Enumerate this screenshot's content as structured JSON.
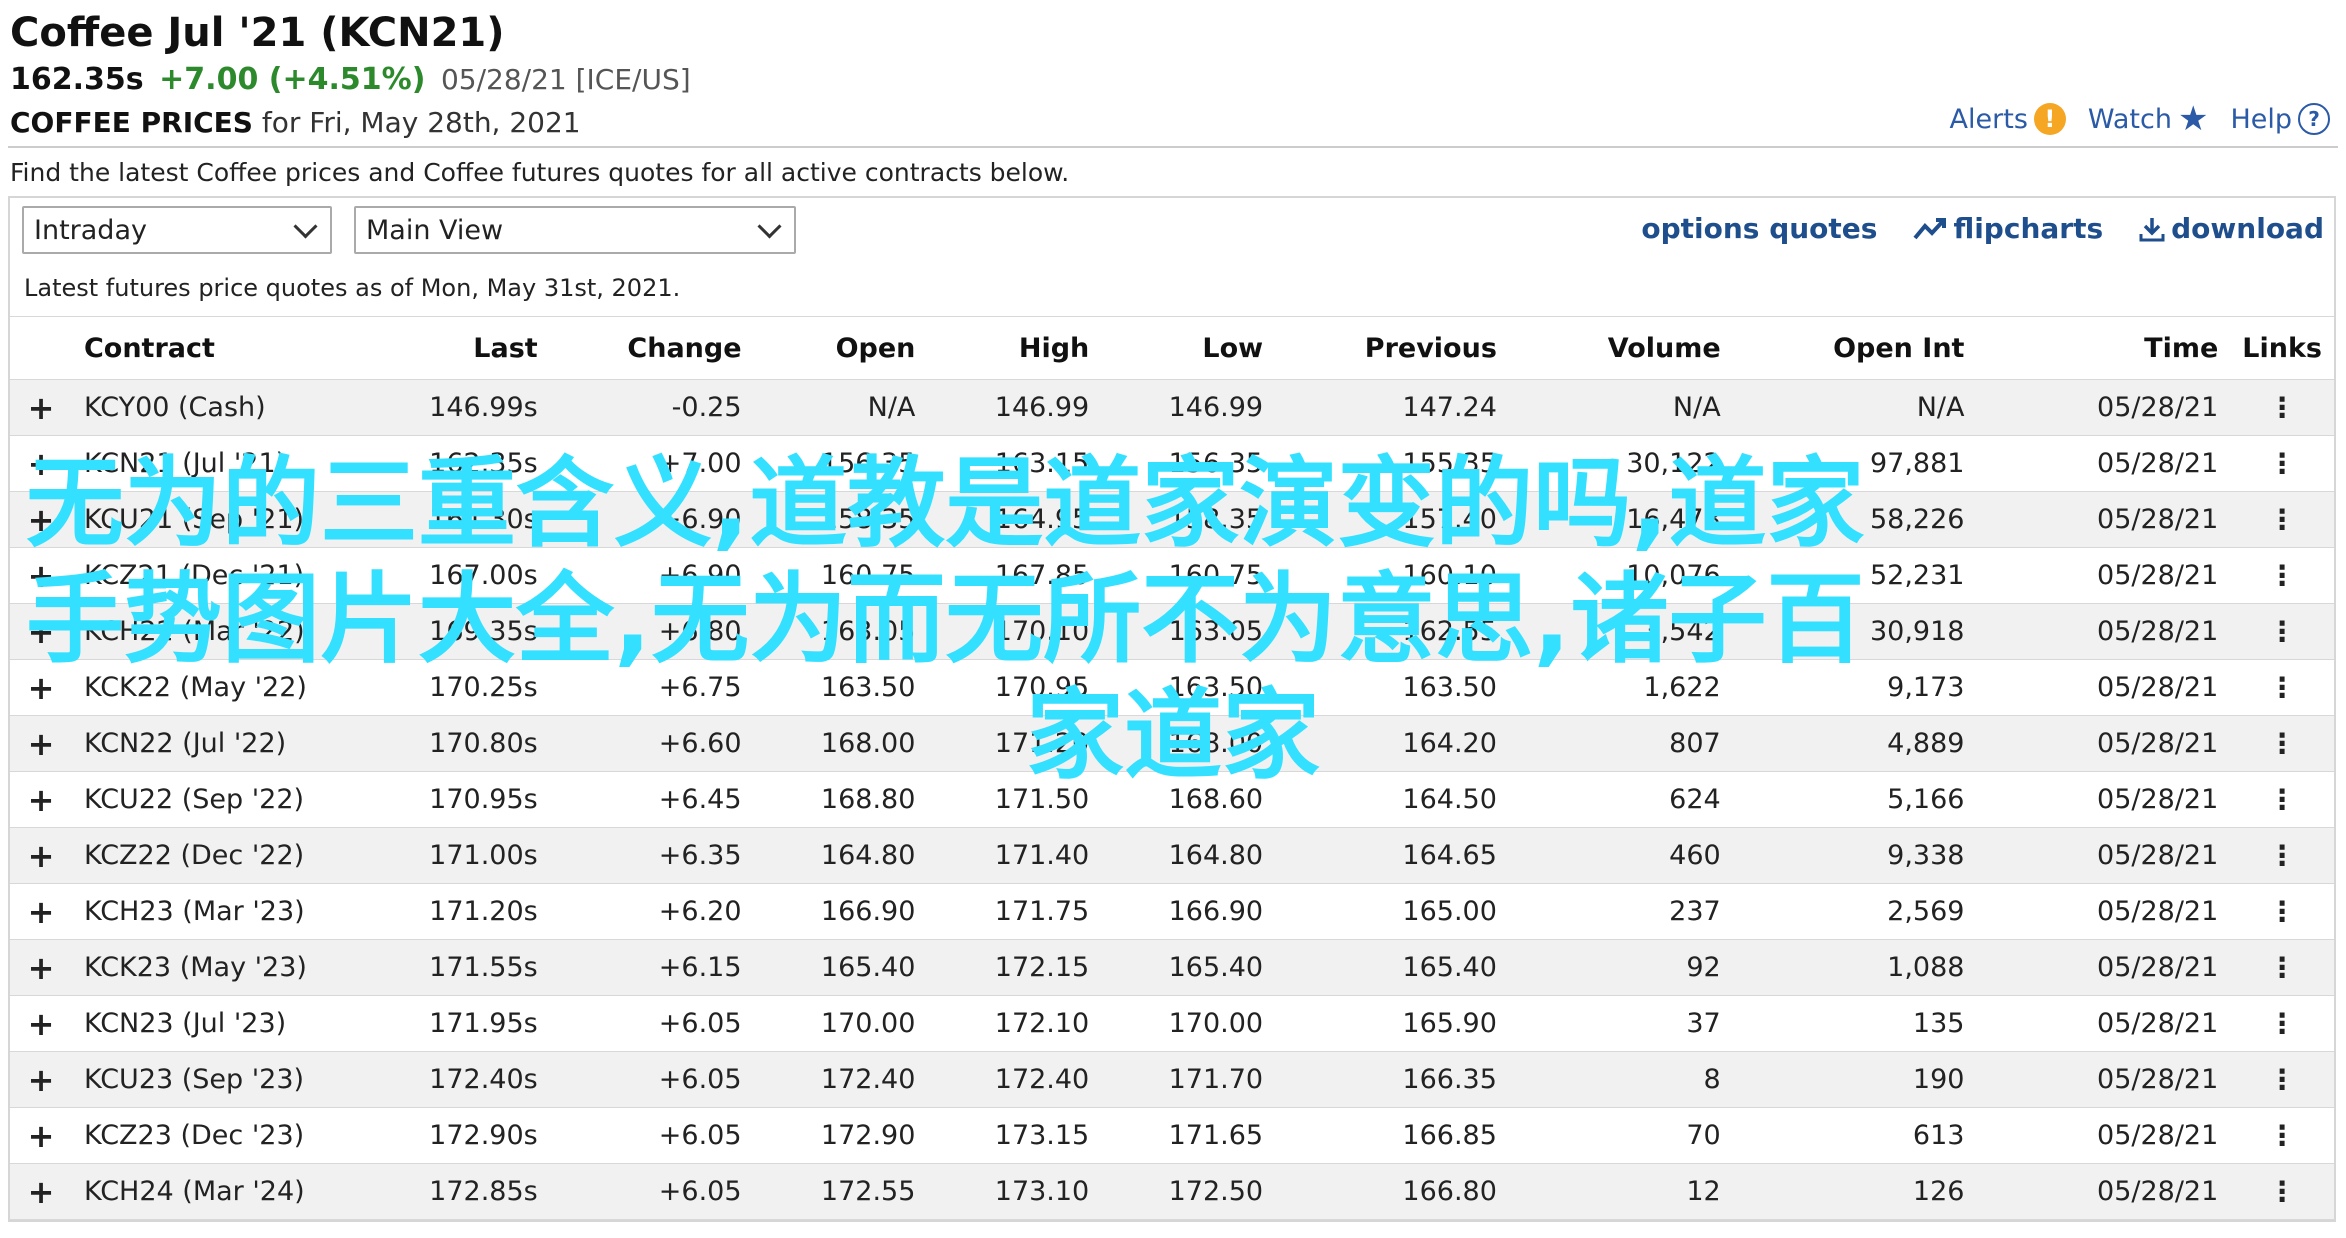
{
  "header": {
    "title": "Coffee Jul '21 (KCN21)",
    "last": "162.35s",
    "change": "+7.00 (+4.51%)",
    "meta": "05/28/21 [ICE/US]",
    "prices_label": "COFFEE PRICES",
    "prices_date": "for Fri, May 28th, 2021",
    "links": {
      "alerts": "Alerts",
      "watch": "Watch",
      "help": "Help"
    }
  },
  "description": "Find the latest Coffee prices and Coffee futures quotes for all active contracts below.",
  "controls": {
    "interval": "Intraday",
    "view": "Main View",
    "options_quotes": "options quotes",
    "flipcharts": "flipcharts",
    "download": "download"
  },
  "as_of": "Latest futures price quotes as of Mon, May 31st, 2021.",
  "table": {
    "columns": [
      "Contract",
      "Last",
      "Change",
      "Open",
      "High",
      "Low",
      "Previous",
      "Volume",
      "Open Int",
      "Time",
      "Links"
    ],
    "rows": [
      [
        "KCY00 (Cash)",
        "146.99s",
        "-0.25",
        "N/A",
        "146.99",
        "146.99",
        "147.24",
        "N/A",
        "N/A",
        "05/28/21"
      ],
      [
        "KCN21 (Jul '21)",
        "162.35s",
        "+7.00",
        "156.35",
        "163.15",
        "156.35",
        "155.35",
        "30,122",
        "97,881",
        "05/28/21"
      ],
      [
        "KCU21 (Sep '21)",
        "164.30s",
        "+6.90",
        "158.35",
        "164.95",
        "158.35",
        "157.40",
        "16,478",
        "58,226",
        "05/28/21"
      ],
      [
        "KCZ21 (Dec '21)",
        "167.00s",
        "+6.90",
        "160.75",
        "167.85",
        "160.75",
        "160.10",
        "10,076",
        "52,231",
        "05/28/21"
      ],
      [
        "KCH22 (Mar '22)",
        "169.35s",
        "+6.80",
        "163.05",
        "170.10",
        "163.05",
        "162.55",
        "3,542",
        "30,918",
        "05/28/21"
      ],
      [
        "KCK22 (May '22)",
        "170.25s",
        "+6.75",
        "163.50",
        "170.95",
        "163.50",
        "163.50",
        "1,622",
        "9,173",
        "05/28/21"
      ],
      [
        "KCN22 (Jul '22)",
        "170.80s",
        "+6.60",
        "168.00",
        "171.20",
        "168.00",
        "164.20",
        "807",
        "4,889",
        "05/28/21"
      ],
      [
        "KCU22 (Sep '22)",
        "170.95s",
        "+6.45",
        "168.80",
        "171.50",
        "168.60",
        "164.50",
        "624",
        "5,166",
        "05/28/21"
      ],
      [
        "KCZ22 (Dec '22)",
        "171.00s",
        "+6.35",
        "164.80",
        "171.40",
        "164.80",
        "164.65",
        "460",
        "9,338",
        "05/28/21"
      ],
      [
        "KCH23 (Mar '23)",
        "171.20s",
        "+6.20",
        "166.90",
        "171.75",
        "166.90",
        "165.00",
        "237",
        "2,569",
        "05/28/21"
      ],
      [
        "KCK23 (May '23)",
        "171.55s",
        "+6.15",
        "165.40",
        "172.15",
        "165.40",
        "165.40",
        "92",
        "1,088",
        "05/28/21"
      ],
      [
        "KCN23 (Jul '23)",
        "171.95s",
        "+6.05",
        "170.00",
        "172.10",
        "170.00",
        "165.90",
        "37",
        "135",
        "05/28/21"
      ],
      [
        "KCU23 (Sep '23)",
        "172.40s",
        "+6.05",
        "172.40",
        "172.40",
        "171.70",
        "166.35",
        "8",
        "190",
        "05/28/21"
      ],
      [
        "KCZ23 (Dec '23)",
        "172.90s",
        "+6.05",
        "172.90",
        "173.15",
        "171.65",
        "166.85",
        "70",
        "613",
        "05/28/21"
      ],
      [
        "KCH24 (Mar '24)",
        "172.85s",
        "+6.05",
        "172.55",
        "173.10",
        "172.50",
        "166.80",
        "12",
        "126",
        "05/28/21"
      ]
    ]
  },
  "overlay": {
    "line1": "无为的三重含义,道教是道家演变的吗,道家",
    "line2": "手势图片大全,无为而无所不为意思,诸子百",
    "line3": "家道家"
  },
  "colors": {
    "link": "#1f4e8c",
    "positive": "#2c8a2c",
    "negative": "#d0021b",
    "overlay": "#33e0ff"
  }
}
